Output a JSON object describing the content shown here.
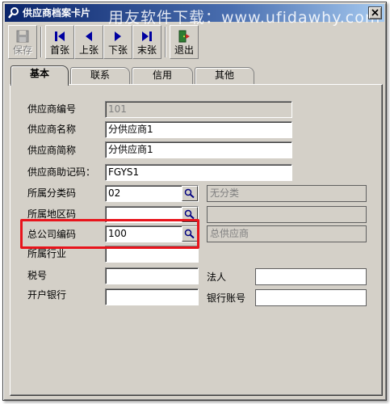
{
  "window": {
    "title": "供应商档案卡片",
    "watermark": "用友软件下载：www.ufidawhy.com"
  },
  "toolbar": {
    "save": "保存",
    "first": "首张",
    "prev": "上张",
    "next": "下张",
    "last": "末张",
    "exit": "退出"
  },
  "tabs": [
    "基本",
    "联系",
    "信用",
    "其他"
  ],
  "form": {
    "vendor_code": {
      "label": "供应商编号",
      "value": "101"
    },
    "vendor_name": {
      "label": "供应商名称",
      "value": "分供应商1"
    },
    "vendor_short": {
      "label": "供应商简称",
      "value": "分供应商1"
    },
    "vendor_mnemonic": {
      "label": "供应商助记码：",
      "value": "FGYS1"
    },
    "category_code": {
      "label": "所属分类码",
      "value": "02",
      "desc": "无分类"
    },
    "region_code": {
      "label": "所属地区码",
      "value": "",
      "desc": ""
    },
    "hq_code": {
      "label": "总公司编码",
      "value": "100",
      "desc": "总供应商"
    },
    "industry": {
      "label": "所属行业",
      "value": ""
    },
    "tax_no": {
      "label": "税号",
      "value": ""
    },
    "legal_person": {
      "label": "法人",
      "value": ""
    },
    "bank": {
      "label": "开户银行",
      "value": ""
    },
    "bank_account": {
      "label": "银行账号",
      "value": ""
    }
  },
  "colors": {
    "highlight": "#e8141c",
    "titlebar_start": "#0a246a",
    "arrow_blue": "#0000a0"
  }
}
